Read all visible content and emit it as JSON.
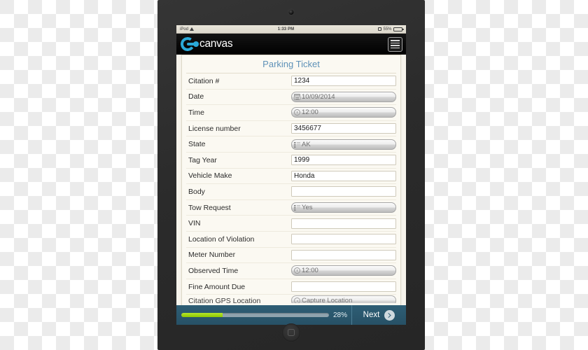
{
  "device": {
    "name": "ipad-tablet",
    "bezel_color": "#2e2e2e"
  },
  "statusbar": {
    "carrier": "iPod",
    "wifi_icon": "wifi-icon",
    "time": "1:33 PM",
    "lock_icon": "rotation-lock-icon",
    "battery_label": "55%",
    "battery_icon": "battery-icon"
  },
  "appbar": {
    "brand": "canvas",
    "logo_icon": "canvas-logo-icon",
    "menu_icon": "hamburger-menu-icon"
  },
  "form": {
    "title": "Parking Ticket",
    "rows": [
      {
        "label": "Citation #",
        "value": "1234",
        "type": "text",
        "icon": ""
      },
      {
        "label": "Date",
        "value": "10/09/2014",
        "type": "picker",
        "icon": "calendar-icon"
      },
      {
        "label": "Time",
        "value": "12:00",
        "type": "picker",
        "icon": "clock-icon"
      },
      {
        "label": "License number",
        "value": "3456677",
        "type": "text",
        "icon": ""
      },
      {
        "label": "State",
        "value": "AK",
        "type": "picker",
        "icon": "list-icon"
      },
      {
        "label": "Tag Year",
        "value": "1999",
        "type": "text",
        "icon": ""
      },
      {
        "label": "Vehicle Make",
        "value": "Honda",
        "type": "text",
        "icon": ""
      },
      {
        "label": "Body",
        "value": "",
        "type": "text",
        "icon": ""
      },
      {
        "label": "Tow Request",
        "value": "Yes",
        "type": "picker",
        "icon": "list-icon"
      },
      {
        "label": "VIN",
        "value": "",
        "type": "text",
        "icon": ""
      },
      {
        "label": "Location of Violation",
        "value": "",
        "type": "text",
        "icon": ""
      },
      {
        "label": "Meter Number",
        "value": "",
        "type": "text",
        "icon": ""
      },
      {
        "label": "Observed Time",
        "value": "12:00",
        "type": "picker",
        "icon": "clock-icon"
      },
      {
        "label": "Fine Amount Due",
        "value": "",
        "type": "text",
        "icon": ""
      },
      {
        "label": "Citation GPS Location",
        "value": "Capture Location",
        "type": "picker",
        "icon": "location-icon"
      }
    ]
  },
  "toolbar": {
    "progress_percent": 28,
    "progress_label": "28%",
    "next_label": "Next",
    "next_icon": "chevron-right-circle-icon",
    "accent_color": "#8ec800",
    "bar_color": "#2e5e75"
  }
}
